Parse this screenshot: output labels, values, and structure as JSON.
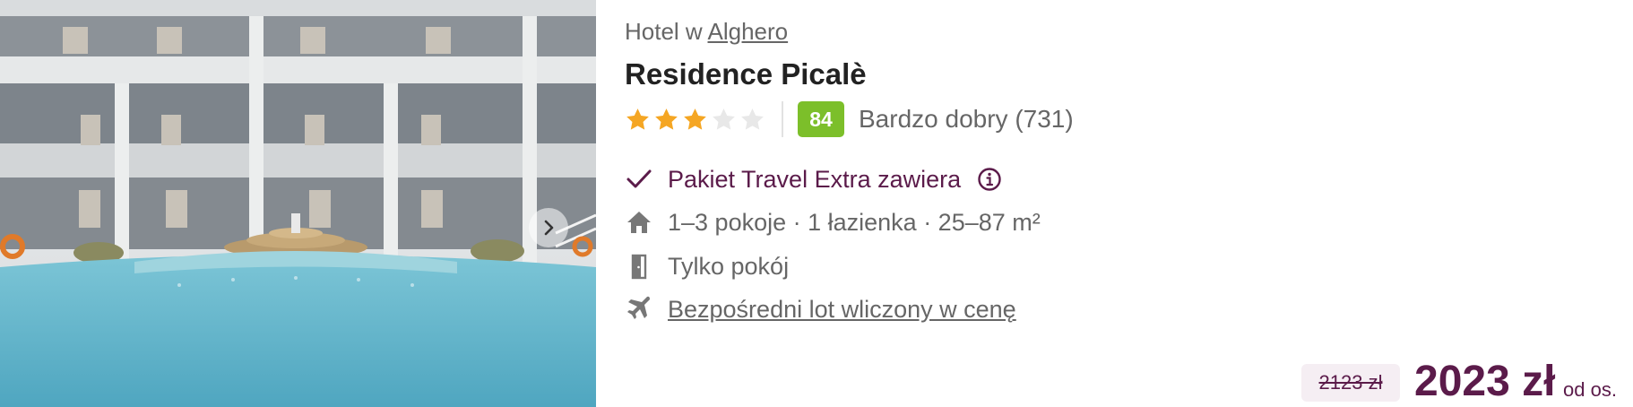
{
  "hotel": {
    "location_prefix": "Hotel w",
    "location_link": "Alghero",
    "name": "Residence Picalè",
    "stars": 3,
    "max_stars": 5,
    "score": "84",
    "rating_text": "Bardzo dobry (731)"
  },
  "features": {
    "package": "Pakiet Travel Extra zawiera",
    "rooms": "1–3 pokoje · 1 łazienka · 25–87 m²",
    "board": "Tylko pokój",
    "flight": "Bezpośredni lot wliczony w cenę"
  },
  "price": {
    "old": "2123 zł",
    "current": "2023 zł",
    "per": "od os."
  },
  "colors": {
    "brand": "#5b1b4a",
    "score_bg": "#7cbf2a",
    "star": "#f5a623",
    "star_empty": "#e8e8e8"
  },
  "icons": [
    "chevron-right-icon",
    "star-icon",
    "check-icon",
    "info-icon",
    "home-icon",
    "door-icon",
    "plane-icon"
  ]
}
